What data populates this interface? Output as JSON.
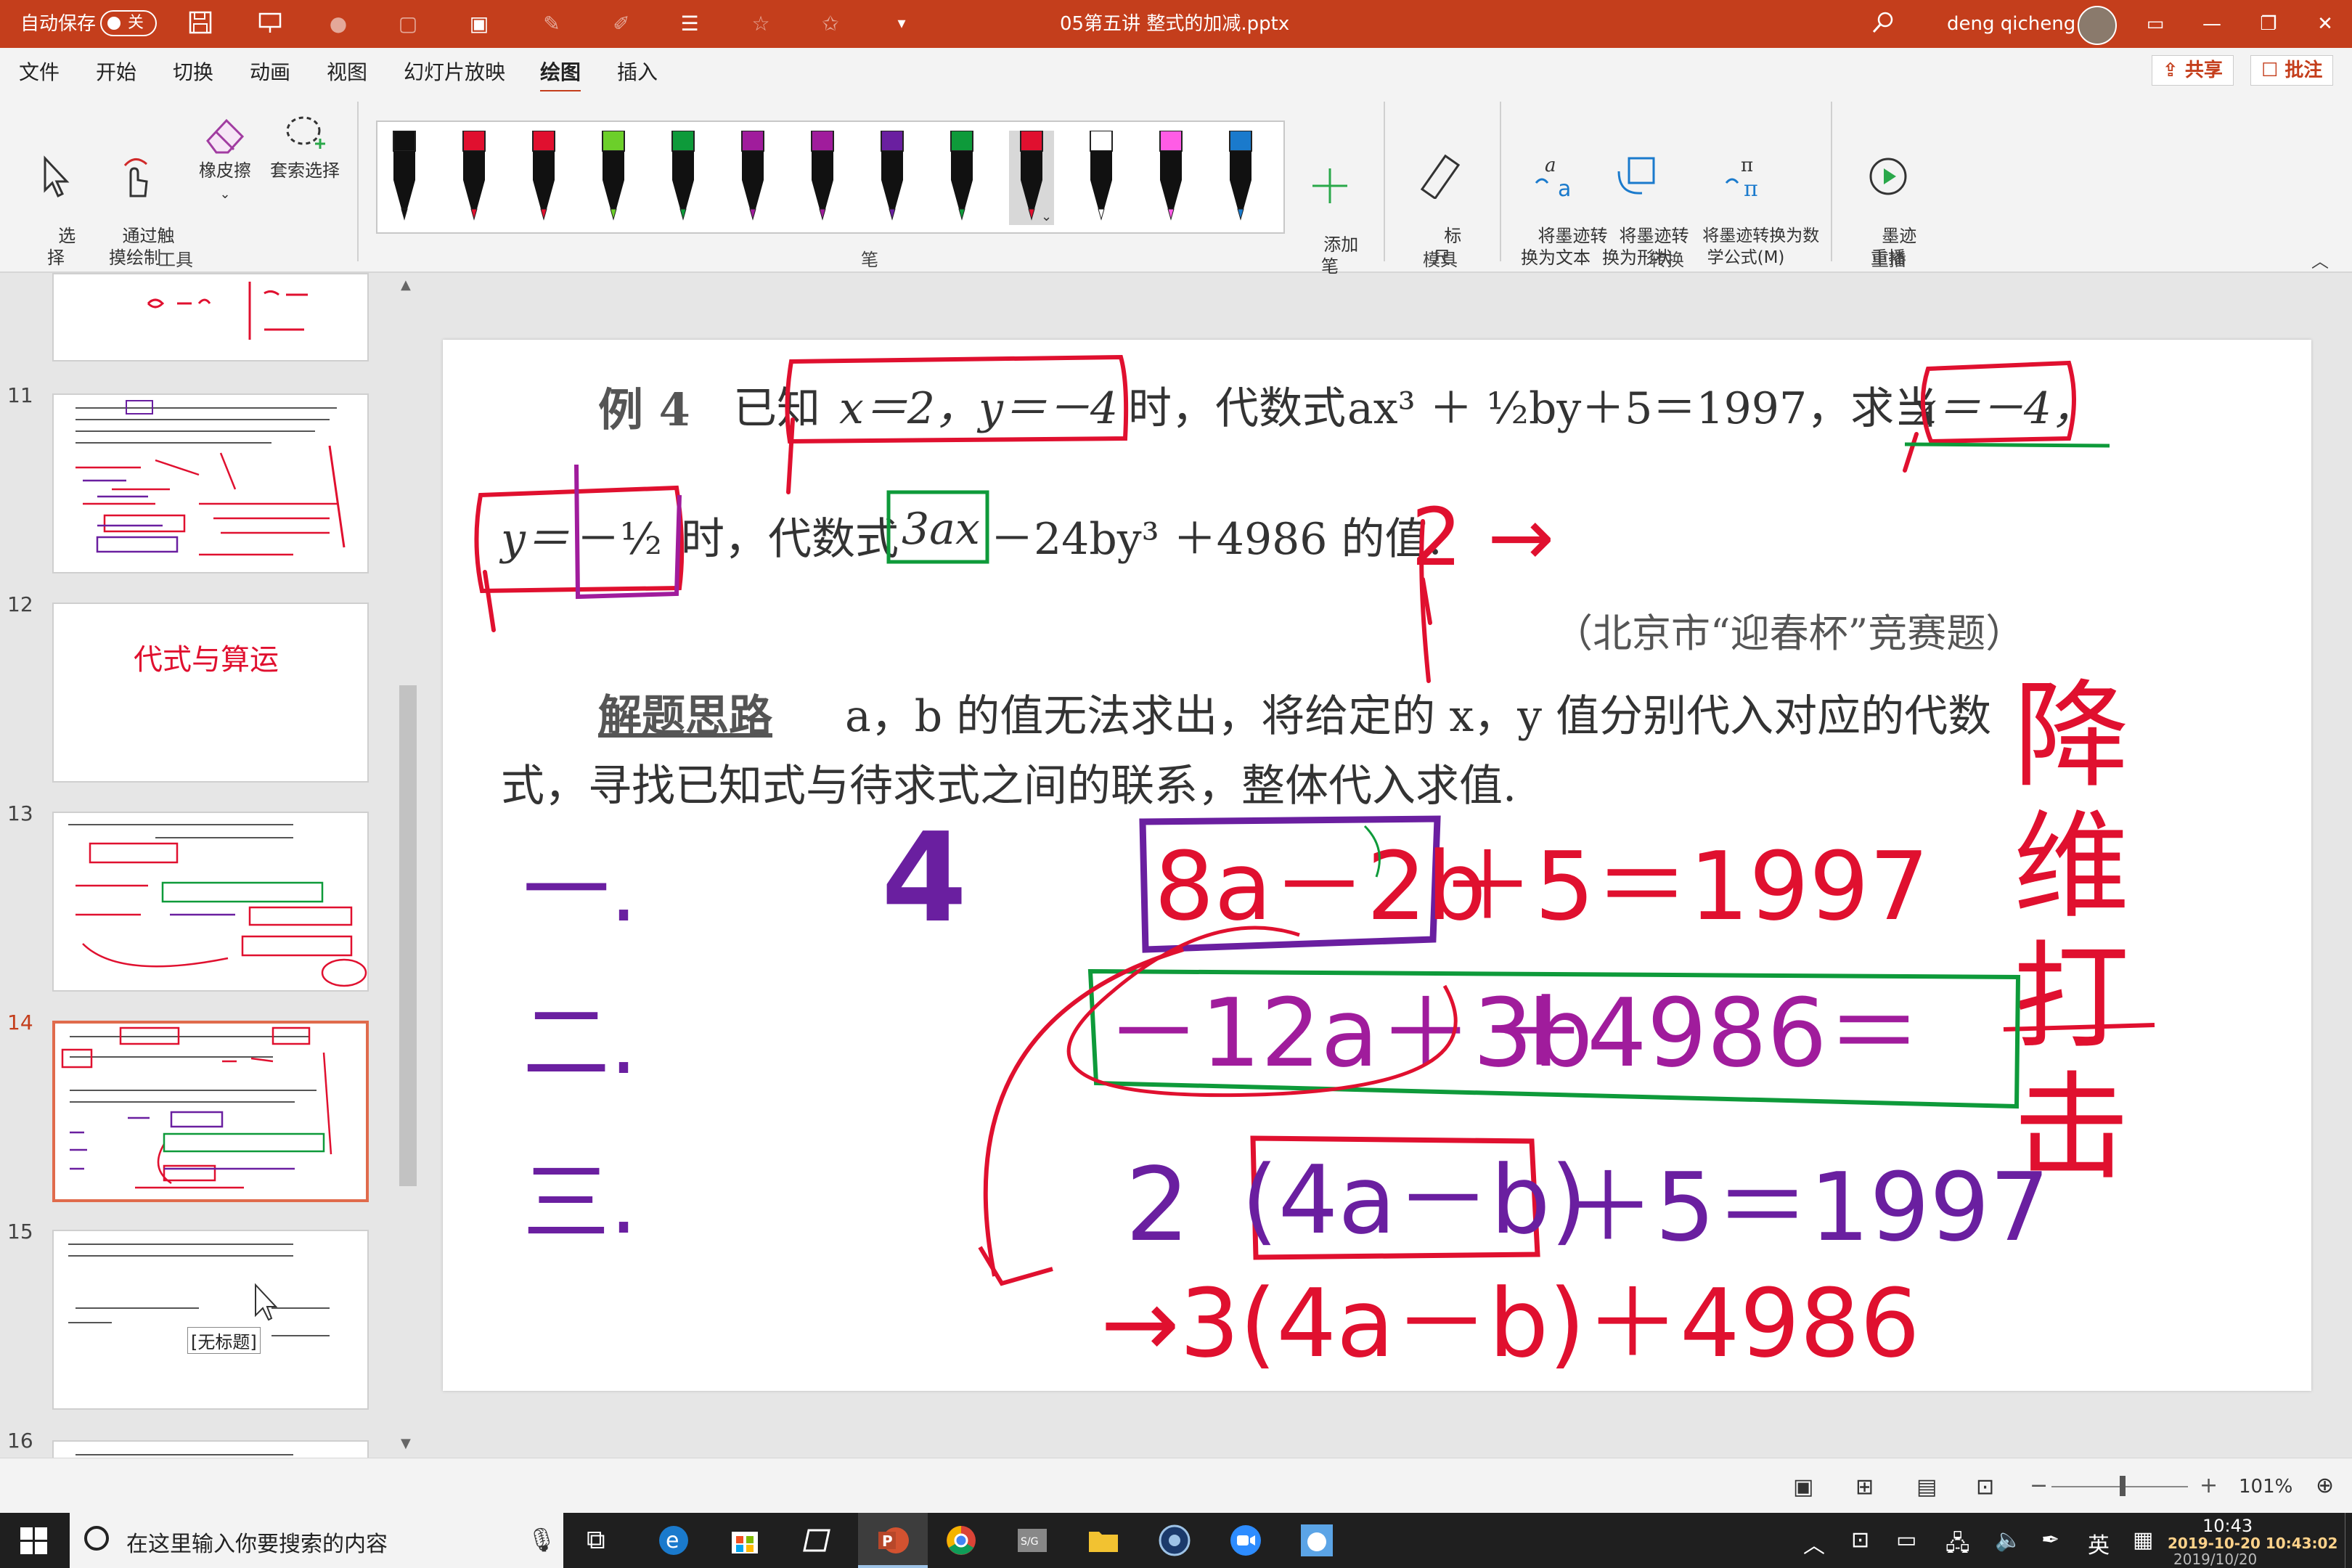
{
  "titlebar": {
    "autosave_label": "自动保存",
    "autosave_state": "关",
    "document_title": "05第五讲 整式的加减.pptx",
    "user_name": "deng qicheng",
    "accent_color": "#c43e1c"
  },
  "menu": {
    "items": [
      "文件",
      "开始",
      "切换",
      "动画",
      "视图",
      "幻灯片放映",
      "绘图",
      "插入"
    ],
    "active": "绘图",
    "share_label": "共享",
    "comment_label": "批注"
  },
  "ribbon": {
    "tools": {
      "select": "选\n择",
      "touch_draw": "通过触\n摸绘制",
      "eraser": "橡皮擦",
      "lasso": "套索选择",
      "group": "工具"
    },
    "pens": {
      "colors": [
        "#111111",
        "#e0102f",
        "#e0102f",
        "#6ccf2a",
        "#0e9a3a",
        "#a01c9c",
        "#a01c9c",
        "#6a1fa0",
        "#0e9a3a",
        "#e0102f",
        "#ffffff",
        "#ff5ce6",
        "#1a7acc"
      ],
      "add_pen": "添加\n笔",
      "group": "笔"
    },
    "ruler": {
      "label": "标\n尺",
      "group": "模具"
    },
    "convert": {
      "ink_to_text": "将墨迹转\n换为文本",
      "ink_to_shape": "将墨迹转\n换为形状",
      "ink_to_math": "将墨迹转换为数\n学公式(M)",
      "group": "转换"
    },
    "replay": {
      "label": "墨迹\n重播",
      "group": "重播"
    }
  },
  "thumbnails": [
    {
      "number": "11"
    },
    {
      "number": "12"
    },
    {
      "number": "13"
    },
    {
      "number": "14",
      "selected": true
    },
    {
      "number": "15"
    },
    {
      "number": "16"
    }
  ],
  "thumb_text": {
    "t12_ink": "代式与算运",
    "t15_placeholder": "[无标题]"
  },
  "slide": {
    "ex_label": "例 4",
    "line1_a": "已知",
    "line1_b": "x＝2，y＝－4",
    "line1_c": "时，代数式",
    "line1_d": "ax³ ＋ ½by＋5＝1997，求当",
    "line1_e": "x＝－4，",
    "line2_a": "y＝",
    "line2_b": "－½",
    "line2_c": "时，代数式",
    "line2_d": "3ax",
    "line2_e": "－24by³ ＋4986 的值.",
    "source": "（北京市“迎春杯”竞赛题）",
    "idea_label": "解题思路",
    "idea_1": "a，b 的值无法求出，将给定的 x，y 值分别代入对应的代数",
    "idea_2": "式，寻找已知式与待求式之间的联系，整体代入求值.",
    "ink_steps": [
      "一.",
      "二.",
      "三."
    ],
    "ink_right_vertical": "降维打击",
    "ink_eq_1a": "8a－2b",
    "ink_eq_1b": "＋5＝1997",
    "ink_eq_2a": "－12a＋3b",
    "ink_eq_2b": "＋4986＝",
    "ink_eq_3a": "2",
    "ink_eq_3b": "(4a－b)",
    "ink_eq_3c": "＋5＝1997",
    "ink_eq_4": "→3(4a－b)＋4986",
    "ink_four": "4",
    "ink_two_arrow": "2 →"
  },
  "statusbar": {
    "zoom": "101%"
  },
  "taskbar": {
    "search_placeholder": "在这里输入你要搜索的内容",
    "time": "10:43",
    "datetime_overlay": "2019-10-20 10:43:02",
    "date": "2019/10/20",
    "ime": "英"
  }
}
